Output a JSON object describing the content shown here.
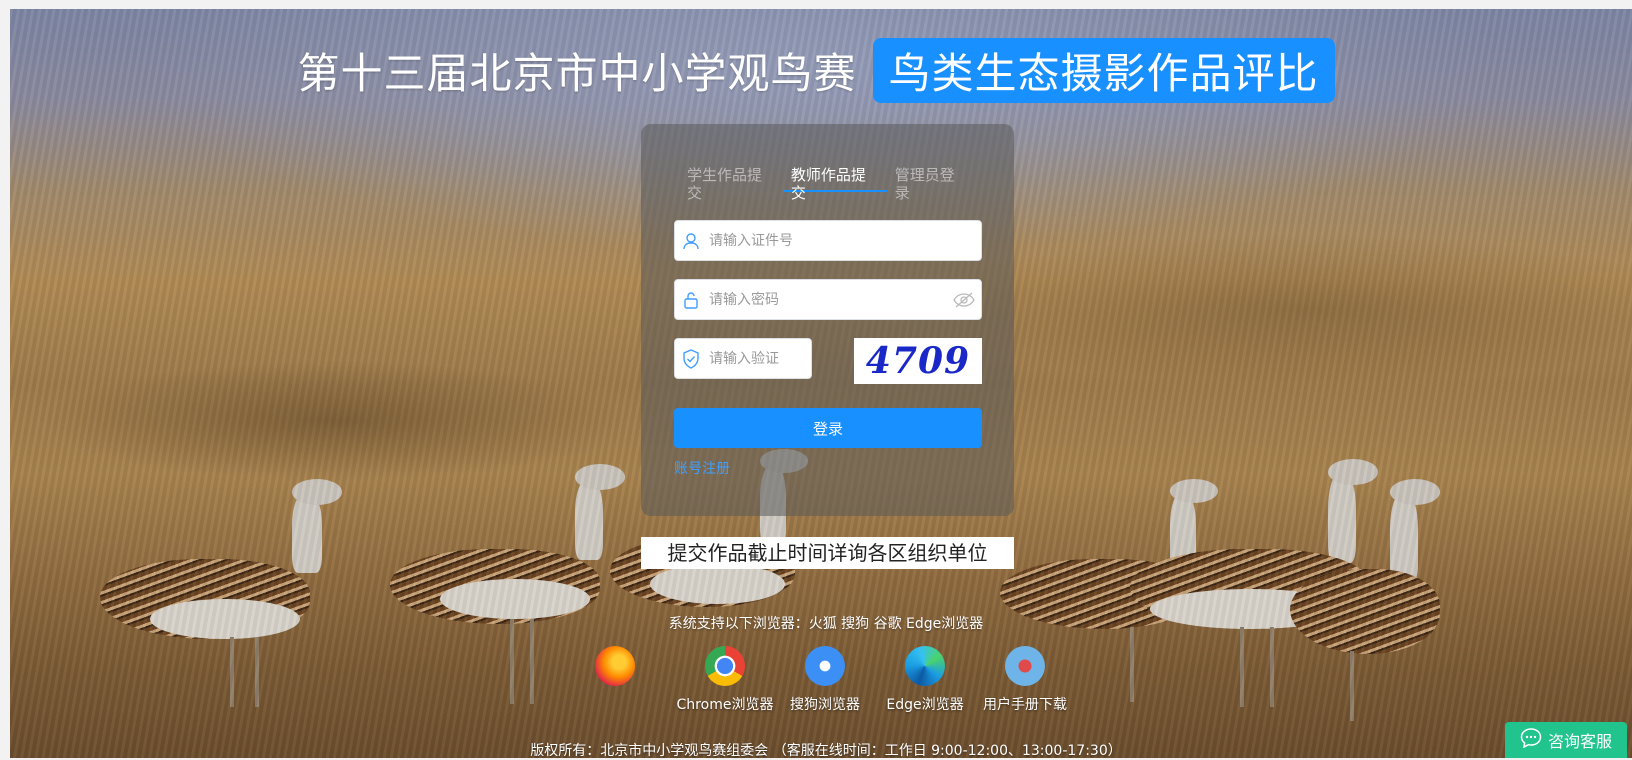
{
  "header": {
    "title_main": "第十三届北京市中小学观鸟赛",
    "title_badge": "鸟类生态摄影作品评比",
    "colors": {
      "badge": "#1890ff"
    }
  },
  "login": {
    "tabs": [
      {
        "label": "学生作品提交",
        "active": false
      },
      {
        "label": "教师作品提交",
        "active": true
      },
      {
        "label": "管理员登录",
        "active": false
      }
    ],
    "id_placeholder": "请输入证件号",
    "password_placeholder": "请输入密码",
    "captcha_placeholder": "请输入验证",
    "captcha_text": "4709",
    "login_button": "登录",
    "register_link": "账号注册",
    "icons": {
      "id": "user-icon",
      "password": "lock-icon",
      "captcha": "shield-check-icon",
      "toggle": "eye-off-icon"
    }
  },
  "notice": "提交作品截止时间详询各区组织单位",
  "support_text": "系统支持以下浏览器：火狐 搜狗 谷歌 Edge浏览器",
  "browsers": [
    {
      "icon": "firefox-icon"
    },
    {
      "label": "Chrome浏览器",
      "icon": "chrome-icon"
    },
    {
      "label": "搜狗浏览器",
      "icon": "sogou-icon"
    },
    {
      "label": "Edge浏览器",
      "icon": "edge-icon"
    },
    {
      "label": "用户手册下载",
      "icon": "manual-icon"
    }
  ],
  "copyright": "版权所有：北京市中小学观鸟赛组委会 （客服在线时间：工作日 9:00-12:00、13:00-17:30）",
  "service_button": "咨询客服"
}
